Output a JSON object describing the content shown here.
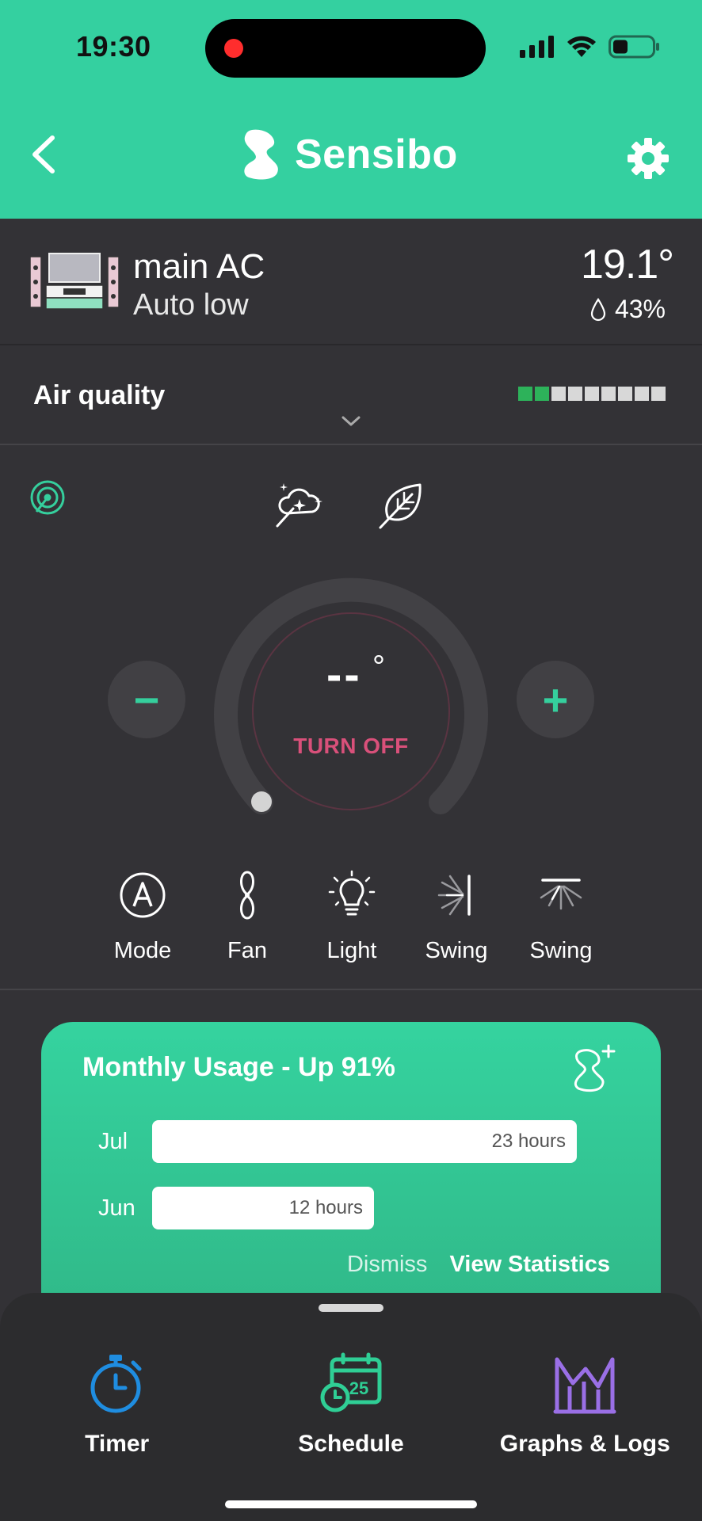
{
  "status_bar": {
    "time": "19:30"
  },
  "header": {
    "brand": "Sensibo"
  },
  "device": {
    "name": "main AC",
    "mode": "Auto low",
    "room_temp": "19.1°",
    "humidity": "43%"
  },
  "air_quality": {
    "label": "Air quality",
    "level_segments": 2,
    "total_segments": 9
  },
  "dial": {
    "target_temp": "--",
    "degree": "°",
    "power_label": "TURN OFF"
  },
  "controls": [
    {
      "label": "Mode",
      "icon": "mode-auto-icon"
    },
    {
      "label": "Fan",
      "icon": "fan-icon"
    },
    {
      "label": "Light",
      "icon": "light-bulb-icon"
    },
    {
      "label": "Swing",
      "icon": "horizontal-swing-icon"
    },
    {
      "label": "Swing",
      "icon": "vertical-swing-icon"
    }
  ],
  "usage": {
    "title": "Monthly Usage - Up 91%",
    "rows": [
      {
        "month": "Jul",
        "value": "23 hours",
        "hours": 23
      },
      {
        "month": "Jun",
        "value": "12 hours",
        "hours": 12
      }
    ],
    "dismiss": "Dismiss",
    "view_statistics": "View Statistics"
  },
  "tabs": [
    {
      "label": "Timer",
      "icon": "timer-icon",
      "color": "#1f8de0"
    },
    {
      "label": "Schedule",
      "icon": "schedule-icon",
      "color": "#2fce95"
    },
    {
      "label": "Graphs & Logs",
      "icon": "graphs-icon",
      "color": "#9a6fe6"
    }
  ],
  "colors": {
    "accent": "#34d0a0",
    "off": "#d9507a",
    "background": "#333236"
  }
}
